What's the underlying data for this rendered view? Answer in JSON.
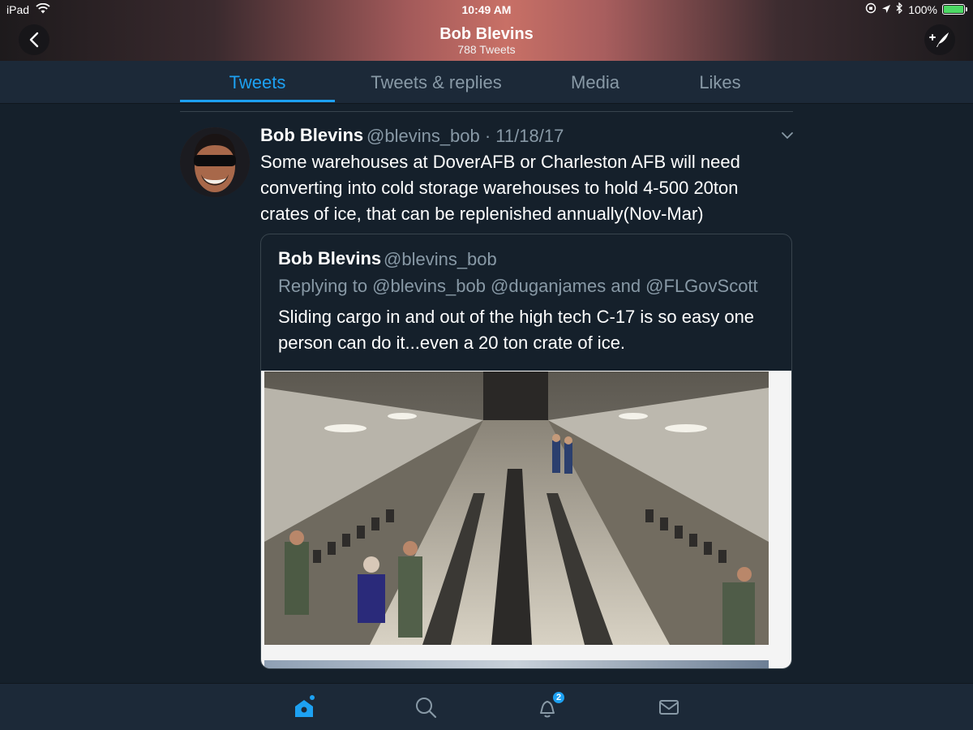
{
  "status_bar": {
    "device": "iPad",
    "time": "10:49 AM",
    "battery": "100%",
    "battery_level": 1.0
  },
  "nav": {
    "title": "Bob Blevins",
    "subtitle": "788 Tweets",
    "back_icon": "chevron-left-icon",
    "compose_icon": "compose-tweet-icon"
  },
  "tabs": [
    {
      "label": "Tweets",
      "active": true
    },
    {
      "label": "Tweets & replies",
      "active": false
    },
    {
      "label": "Media",
      "active": false
    },
    {
      "label": "Likes",
      "active": false
    }
  ],
  "tweet": {
    "name": "Bob Blevins",
    "meta": "@blevins_bob · 11/18/17",
    "text": "Some warehouses at DoverAFB or Charleston AFB will need converting into cold storage warehouses to hold 4-500 20ton crates of ice, that can be replenished annually(Nov-Mar)",
    "quote": {
      "name": "Bob Blevins",
      "handle": "@blevins_bob",
      "reply_line": "Replying to @blevins_bob @duganjames and @FLGovScott",
      "text": "Sliding cargo in and out of the high tech C-17 is so easy one person can do it...even a 20 ton crate of ice."
    }
  },
  "bottom_bar": {
    "items": [
      "home-icon",
      "search-icon",
      "notifications-icon",
      "messages-icon"
    ],
    "notification_count": "2"
  },
  "colors": {
    "background": "#15202b",
    "bar": "#1c2938",
    "accent": "#1da1f2",
    "secondary_text": "#8899a6"
  }
}
